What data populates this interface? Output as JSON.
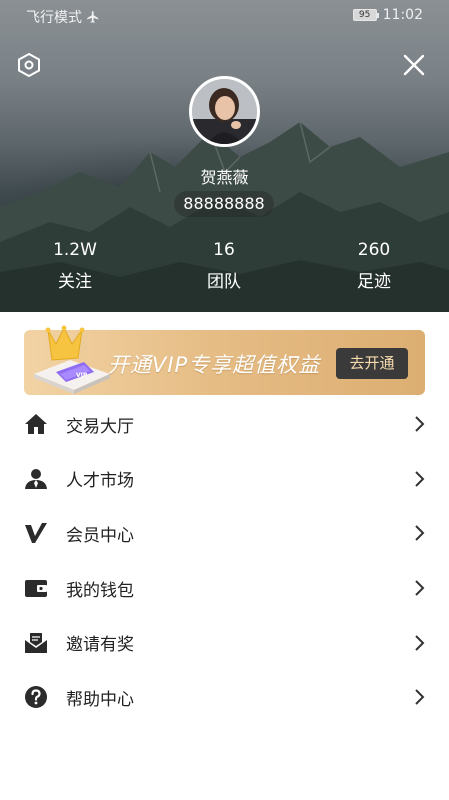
{
  "status_bar": {
    "airplane_mode_text": "飞行模式",
    "battery_level": "95",
    "time": "11:02"
  },
  "header": {
    "settings_icon": "settings-hexagon-icon",
    "close_icon": "close-icon",
    "username": "贺燕薇",
    "user_id": "88888888",
    "stats": [
      {
        "value": "1.2W",
        "label": "关注"
      },
      {
        "value": "16",
        "label": "团队"
      },
      {
        "value": "260",
        "label": "足迹"
      }
    ]
  },
  "vip_banner": {
    "text": "开通VIP专享超值权益",
    "button_label": "去开通",
    "card_label": "VIP"
  },
  "menu": {
    "items": [
      {
        "label": "交易大厅",
        "icon": "home-icon"
      },
      {
        "label": "人才市场",
        "icon": "person-icon"
      },
      {
        "label": "会员中心",
        "icon": "v-icon"
      },
      {
        "label": "我的钱包",
        "icon": "wallet-icon"
      },
      {
        "label": "邀请有奖",
        "icon": "envelope-icon"
      },
      {
        "label": "帮助中心",
        "icon": "question-icon"
      }
    ]
  },
  "colors": {
    "banner_gold": "#e6bd86",
    "banner_button": "#3a3a3a",
    "icon_dark": "#2b2b2b"
  }
}
